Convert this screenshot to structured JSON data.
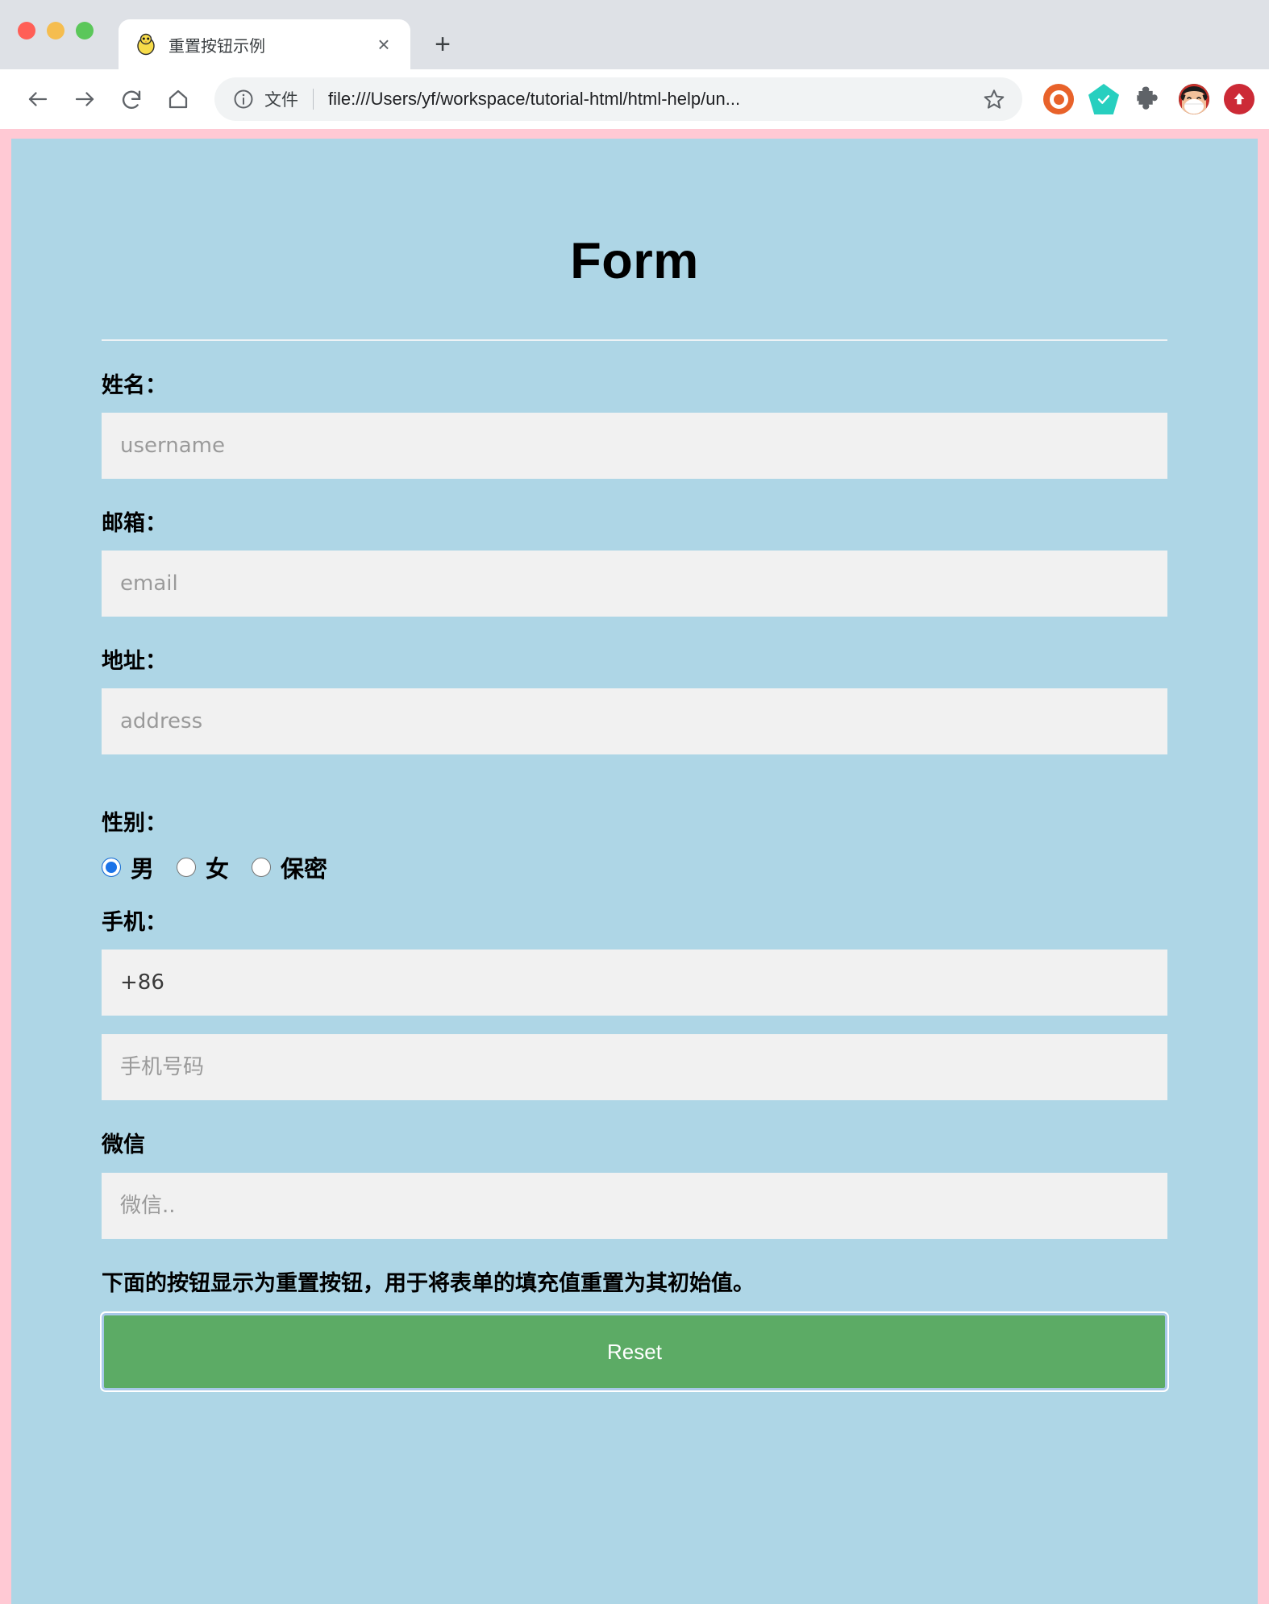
{
  "browser": {
    "window_controls": [
      "close",
      "minimize",
      "maximize"
    ],
    "tab": {
      "title": "重置按钮示例",
      "favicon": "chick-favicon",
      "close_label": "×"
    },
    "new_tab_label": "+",
    "toolbar": {
      "back_label": "back-icon",
      "forward_label": "forward-icon",
      "reload_label": "reload-icon",
      "home_label": "home-icon",
      "scheme_label": "文件",
      "url": "file:///Users/yf/workspace/tutorial-html/html-help/un...",
      "bookmark_label": "star-icon"
    },
    "extensions": [
      {
        "name": "ubuntu-extension-icon",
        "color": "#e8622a"
      },
      {
        "name": "check-extension-icon",
        "color": "#27cfbf",
        "glyph": "✔"
      },
      {
        "name": "puzzle-extensions-icon",
        "color": "#5f6368"
      },
      {
        "name": "profile-avatar-icon",
        "color": "#3a2a22"
      },
      {
        "name": "upload-extension-icon",
        "color": "#cc2a36",
        "glyph": "⬆"
      }
    ]
  },
  "page": {
    "title": "Form",
    "colors": {
      "body_background": "#ffc9d4",
      "content_background": "#aed6e6",
      "input_background": "#f1f1f1",
      "button_background": "#5cab65",
      "divider": "#eef3f6",
      "radio_selected": "#1b73e8"
    },
    "fields": [
      {
        "label": "姓名：",
        "name": "username",
        "placeholder": "username",
        "value": ""
      },
      {
        "label": "邮箱：",
        "name": "email",
        "placeholder": "email",
        "value": ""
      },
      {
        "label": "地址：",
        "name": "address",
        "placeholder": "address",
        "value": ""
      }
    ],
    "gender": {
      "label": "性别：",
      "options": [
        {
          "label": "男",
          "checked": true
        },
        {
          "label": "女",
          "checked": false
        },
        {
          "label": "保密",
          "checked": false
        }
      ]
    },
    "phone": {
      "label": "手机：",
      "country_code_value": "+86",
      "country_code_placeholder": "",
      "number_placeholder": "手机号码",
      "number_value": ""
    },
    "wechat": {
      "label": "微信",
      "placeholder": "微信..",
      "value": ""
    },
    "description": "下面的按钮显示为重置按钮，用于将表单的填充值重置为其初始值。",
    "reset_button_label": "Reset"
  }
}
